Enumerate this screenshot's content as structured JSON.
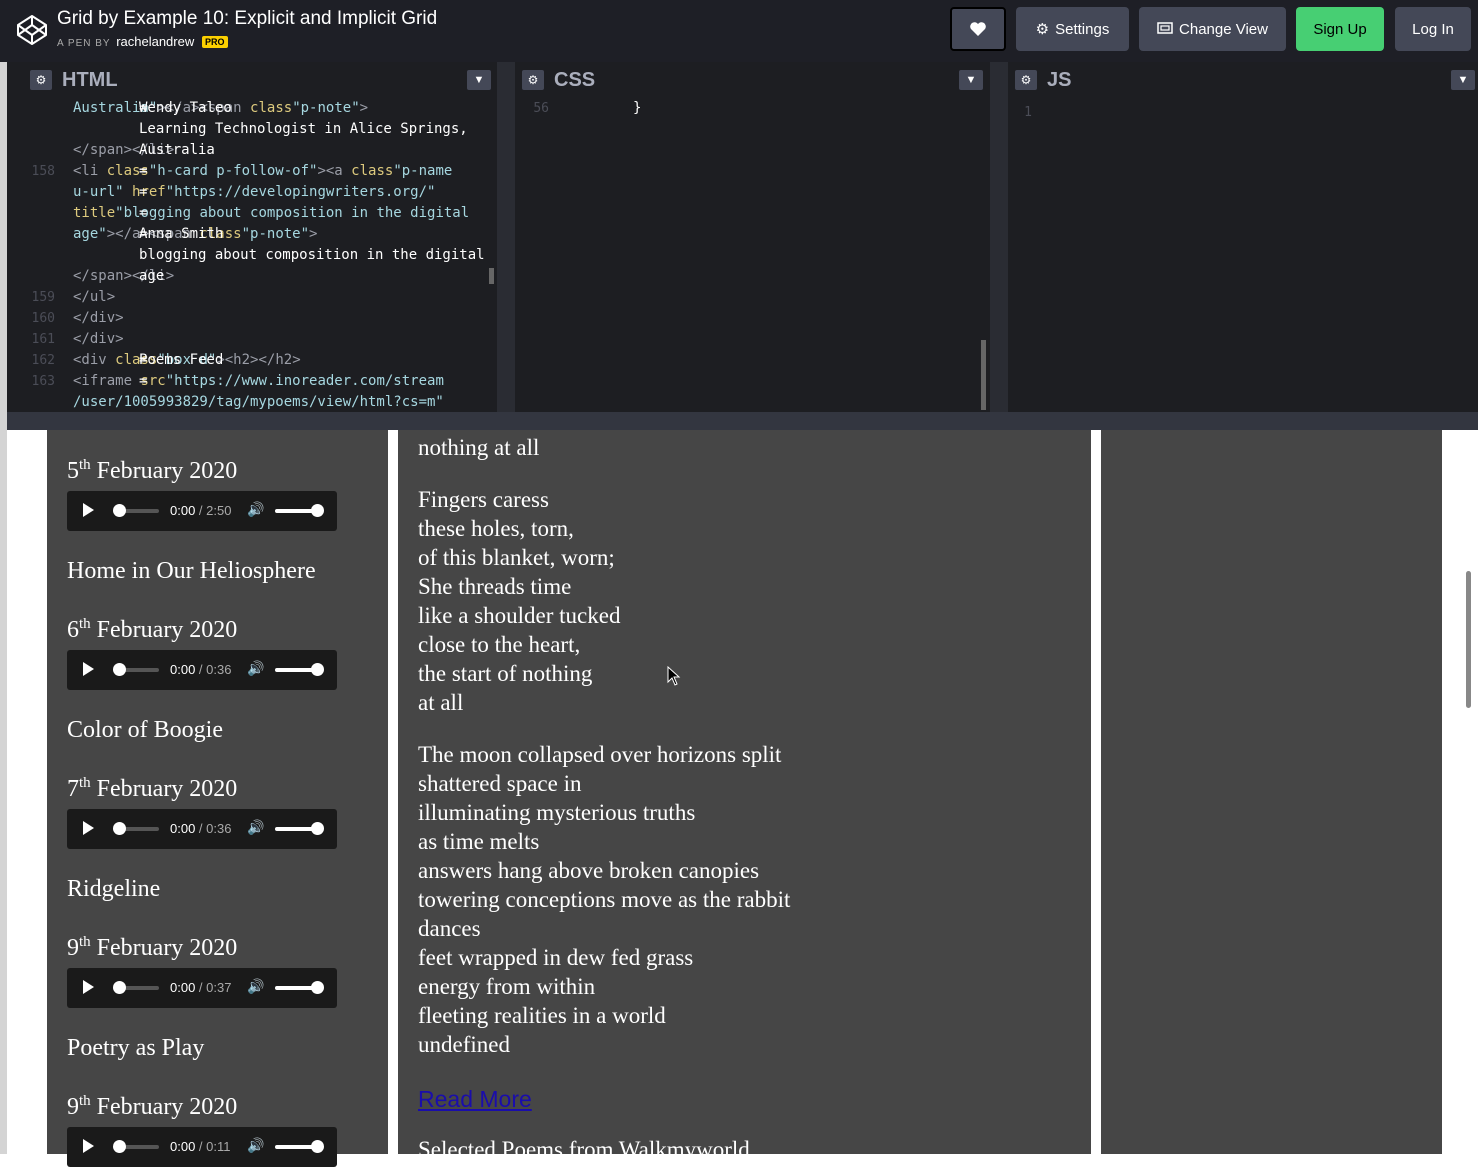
{
  "header": {
    "title": "Grid by Example 10: Explicit and Implicit Grid",
    "by_label": "A PEN BY",
    "author": "rachelandrew",
    "badge": "PRO",
    "buttons": {
      "settings": "Settings",
      "change_view": "Change View",
      "sign_up": "Sign Up",
      "log_in": "Log In"
    }
  },
  "editors": {
    "html": {
      "name": "HTML",
      "lines": [
        {
          "n": "",
          "segs": [
            [
              "sv",
              "Australia\""
            ],
            [
              "tg",
              ">"
            ],
            [
              "ct",
              "Wendy Taleo"
            ],
            [
              "tg",
              "</a>"
            ],
            [
              "ct",
              " "
            ],
            [
              "tg",
              "<span "
            ],
            [
              "at",
              "class"
            ],
            [
              "ct",
              "="
            ],
            [
              "sv",
              "\"p-note\""
            ],
            [
              "tg",
              ">"
            ]
          ]
        },
        {
          "n": "",
          "segs": [
            [
              "ct",
              "Learning Technologist in Alice Springs,"
            ]
          ]
        },
        {
          "n": "",
          "segs": [
            [
              "ct",
              "Australia"
            ],
            [
              "tg",
              "</span></li>"
            ]
          ]
        },
        {
          "n": "158",
          "segs": [
            [
              "tg",
              "<li "
            ],
            [
              "at",
              "class"
            ],
            [
              "ct",
              "="
            ],
            [
              "sv",
              "\"h-card p-follow-of\""
            ],
            [
              "tg",
              "><a "
            ],
            [
              "at",
              "class"
            ],
            [
              "ct",
              "="
            ],
            [
              "sv",
              "\"p-name"
            ]
          ]
        },
        {
          "n": "",
          "segs": [
            [
              "sv",
              "u-url\" "
            ],
            [
              "at",
              "href"
            ],
            [
              "ct",
              "="
            ],
            [
              "sv",
              "\"https://developingwriters.org/\""
            ]
          ]
        },
        {
          "n": "",
          "segs": [
            [
              "at",
              "title"
            ],
            [
              "ct",
              "="
            ],
            [
              "sv",
              "\"blogging about composition in the digital"
            ]
          ]
        },
        {
          "n": "",
          "segs": [
            [
              "sv",
              "age\""
            ],
            [
              "tg",
              ">"
            ],
            [
              "ct",
              "Anna Smith"
            ],
            [
              "tg",
              "</a>"
            ],
            [
              "ct",
              " "
            ],
            [
              "tg",
              "<span "
            ],
            [
              "at",
              "class"
            ],
            [
              "ct",
              "="
            ],
            [
              "sv",
              "\"p-note\""
            ],
            [
              "tg",
              ">"
            ]
          ]
        },
        {
          "n": "",
          "segs": [
            [
              "ct",
              "blogging about composition in the digital"
            ]
          ]
        },
        {
          "n": "",
          "segs": [
            [
              "ct",
              "age"
            ],
            [
              "tg",
              "</span></li>"
            ]
          ]
        },
        {
          "n": "159",
          "segs": [
            [
              "tg",
              "</ul>"
            ]
          ]
        },
        {
          "n": "160",
          "segs": [
            [
              "ct",
              "  "
            ],
            [
              "tg",
              "</div>"
            ]
          ]
        },
        {
          "n": "161",
          "segs": [
            [
              "ct",
              "  "
            ],
            [
              "tg",
              "</div>"
            ]
          ]
        },
        {
          "n": "162",
          "segs": [
            [
              "ct",
              "  "
            ],
            [
              "tg",
              "<div "
            ],
            [
              "at",
              "class"
            ],
            [
              "ct",
              "="
            ],
            [
              "sv",
              "\"box d\""
            ],
            [
              "tg",
              "><h2>"
            ],
            [
              "ct",
              "Poems Feed"
            ],
            [
              "tg",
              "</h2>"
            ]
          ]
        },
        {
          "n": "163",
          "segs": [
            [
              "tg",
              "<iframe "
            ],
            [
              "at",
              "src"
            ],
            [
              "ct",
              "="
            ],
            [
              "sv",
              "\"https://www.inoreader.com/stream"
            ]
          ]
        },
        {
          "n": "",
          "segs": [
            [
              "sv",
              "/user/1005993829/tag/mypoems/view/html?cs=m\""
            ]
          ]
        }
      ]
    },
    "css": {
      "name": "CSS",
      "lines": [
        {
          "n": "56",
          "segs": [
            [
              "ct",
              "}"
            ]
          ]
        }
      ]
    },
    "js": {
      "name": "JS",
      "lines": [
        {
          "n": "1",
          "segs": []
        }
      ]
    }
  },
  "preview": {
    "left_column": [
      {
        "type": "date",
        "day": "5",
        "suffix": "th",
        "rest": " February 2020"
      },
      {
        "type": "audio",
        "current": "0:00",
        "total": "2:50"
      },
      {
        "type": "title",
        "text": "Home in Our Heliosphere"
      },
      {
        "type": "date",
        "day": "6",
        "suffix": "th",
        "rest": " February 2020"
      },
      {
        "type": "audio",
        "current": "0:00",
        "total": "0:36"
      },
      {
        "type": "title",
        "text": "Color of Boogie"
      },
      {
        "type": "date",
        "day": "7",
        "suffix": "th",
        "rest": " February 2020"
      },
      {
        "type": "audio",
        "current": "0:00",
        "total": "0:36"
      },
      {
        "type": "title",
        "text": "Ridgeline"
      },
      {
        "type": "date",
        "day": "9",
        "suffix": "th",
        "rest": " February 2020"
      },
      {
        "type": "audio",
        "current": "0:00",
        "total": "0:37"
      },
      {
        "type": "title",
        "text": "Poetry as Play"
      },
      {
        "type": "date",
        "day": "9",
        "suffix": "th",
        "rest": " February 2020"
      },
      {
        "type": "audio",
        "current": "0:00",
        "total": "0:11"
      }
    ],
    "poem_lines": [
      "nothing at all",
      "",
      "Fingers caress",
      "these holes, torn,",
      "of this blanket, worn;",
      "She threads time",
      "like a shoulder tucked",
      "close to the heart,",
      "the start of nothing",
      "at all",
      "",
      "The moon collapsed over horizons split",
      "shattered space in",
      "illuminating mysterious truths",
      "as time melts",
      "answers hang above broken canopies",
      "towering conceptions move as the rabbit",
      "dances",
      "feet wrapped in dew fed grass",
      "energy from within",
      "fleeting realities in a world",
      "undefined"
    ],
    "read_more": "Read More",
    "next_heading": "Selected Poems from Walkmyworld"
  },
  "colors": {
    "header_bg": "#1e1f26",
    "editor_bg": "#1d1e22",
    "button_bg": "#444857",
    "signup_bg": "#47cf73",
    "pro_badge": "#fcd000",
    "preview_box": "#464646",
    "link": "#1a0dab"
  }
}
